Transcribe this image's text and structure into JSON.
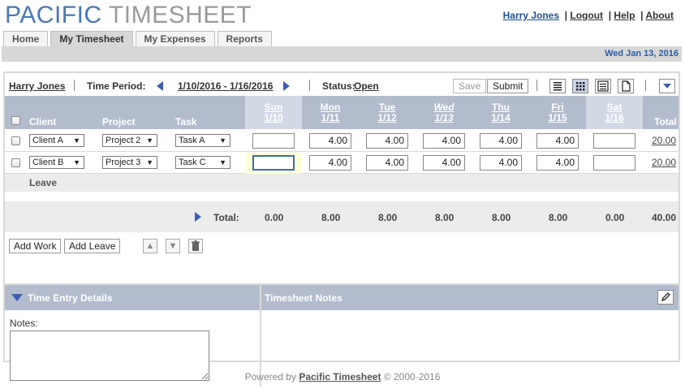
{
  "logo": {
    "part1": "PACIFIC",
    "part2": "TIMESHEET"
  },
  "toplinks": {
    "user": "Harry Jones",
    "logout": "Logout",
    "help": "Help",
    "about": "About",
    "sep": "|"
  },
  "tabs": [
    {
      "label": "Home"
    },
    {
      "label": "My Timesheet"
    },
    {
      "label": "My Expenses"
    },
    {
      "label": "Reports"
    }
  ],
  "date": "Wed Jan 13, 2016",
  "toolbar": {
    "employee": "Harry Jones",
    "period_label": "Time Period:",
    "period": "1/10/2016 - 1/16/2016",
    "status_label": "Status:",
    "status": "Open",
    "save": "Save",
    "submit": "Submit"
  },
  "grid": {
    "headers": {
      "client": "Client",
      "project": "Project",
      "task": "Task",
      "total": "Total"
    },
    "days": [
      {
        "name": "Sun",
        "date": "1/10"
      },
      {
        "name": "Mon",
        "date": "1/11"
      },
      {
        "name": "Tue",
        "date": "1/12"
      },
      {
        "name": "Wed",
        "date": "1/13"
      },
      {
        "name": "Thu",
        "date": "1/14"
      },
      {
        "name": "Fri",
        "date": "1/15"
      },
      {
        "name": "Sat",
        "date": "1/16"
      }
    ],
    "rows": [
      {
        "client": "Client A",
        "project": "Project 2",
        "task": "Task A",
        "hours": [
          "",
          "4.00",
          "4.00",
          "4.00",
          "4.00",
          "4.00",
          ""
        ],
        "total": "20.00"
      },
      {
        "client": "Client B",
        "project": "Project 3",
        "task": "Task C",
        "hours": [
          "",
          "4.00",
          "4.00",
          "4.00",
          "4.00",
          "4.00",
          ""
        ],
        "total": "20.00"
      }
    ],
    "leave_label": "Leave",
    "total_label": "Total:",
    "totals": [
      "0.00",
      "8.00",
      "8.00",
      "8.00",
      "8.00",
      "8.00",
      "0.00"
    ],
    "grand_total": "40.00"
  },
  "actions": {
    "add_work": "Add Work",
    "add_leave": "Add Leave"
  },
  "details": {
    "title": "Time Entry Details",
    "notes_label": "Notes:"
  },
  "timesheet_notes": {
    "title": "Timesheet Notes"
  },
  "footer": {
    "prefix": "Powered by",
    "link": "Pacific Timesheet",
    "suffix": "© 2000-2016"
  }
}
